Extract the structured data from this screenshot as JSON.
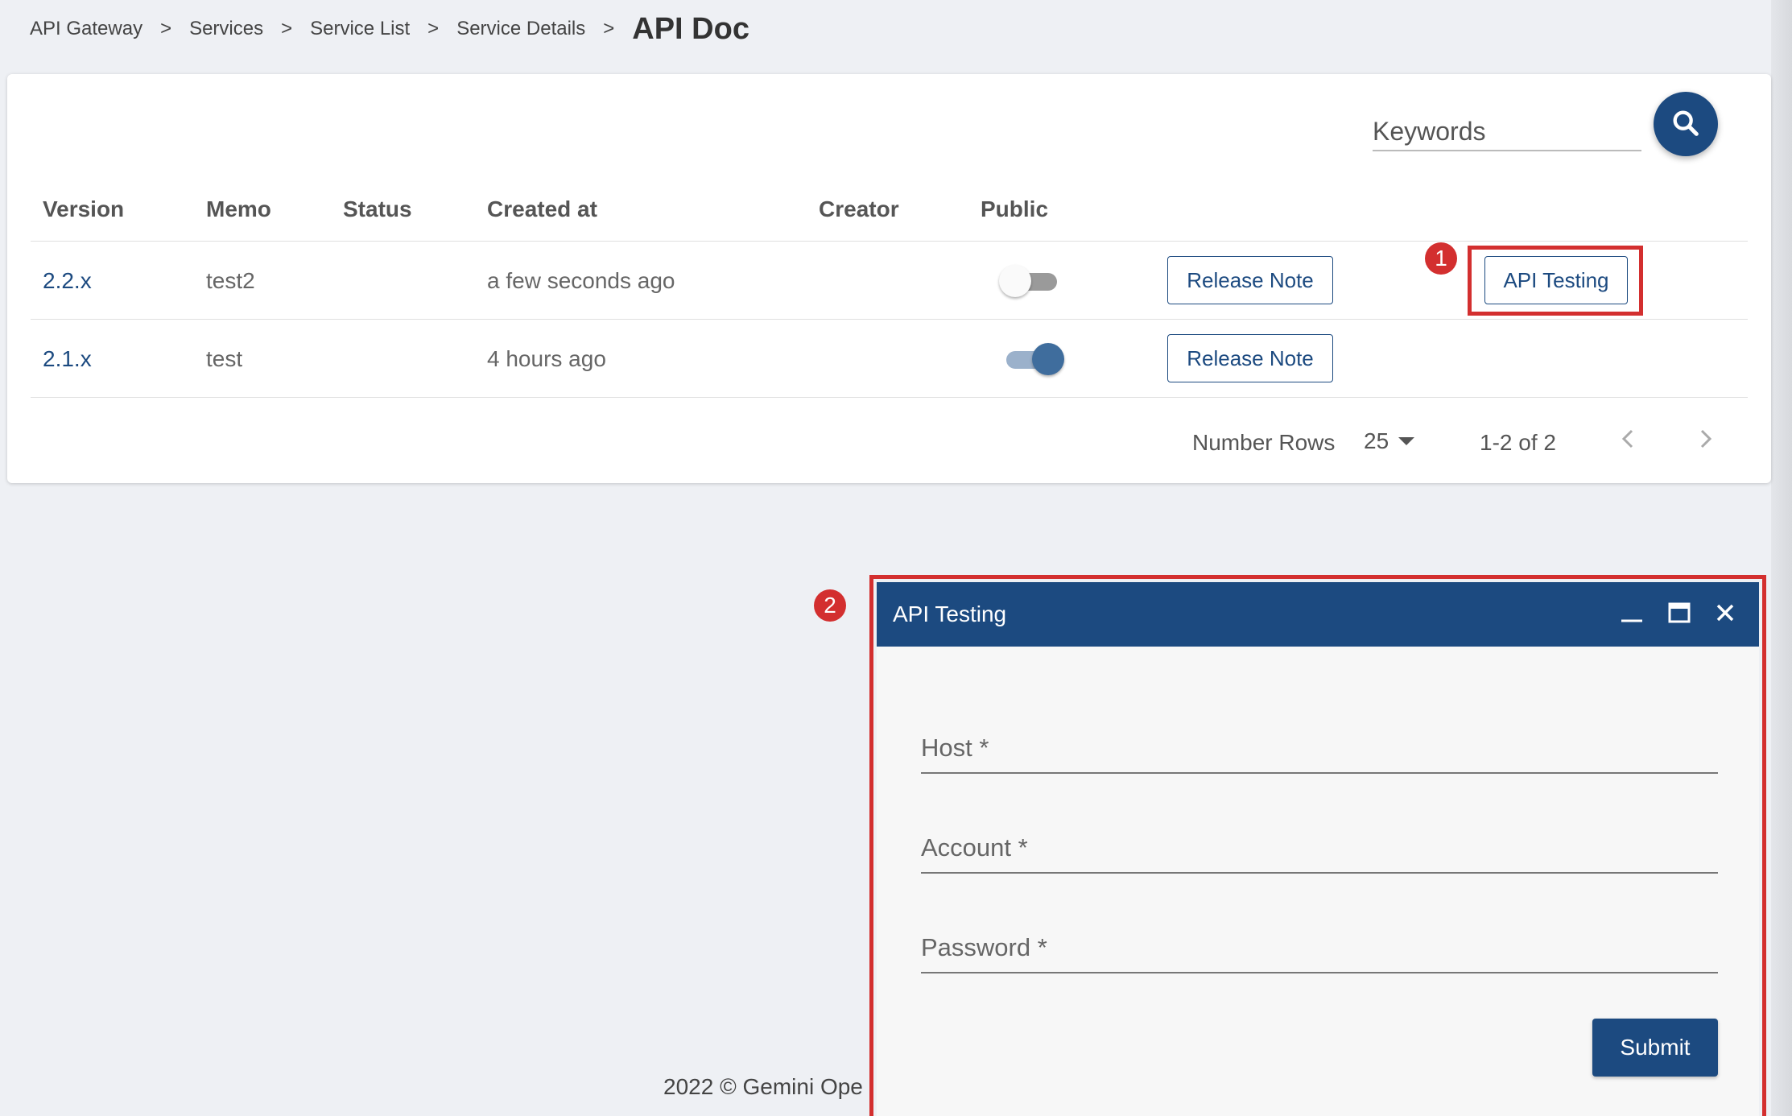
{
  "breadcrumb": {
    "items": [
      "API Gateway",
      "Services",
      "Service List",
      "Service Details"
    ],
    "current": "API Doc",
    "separator": ">"
  },
  "search": {
    "placeholder": "Keywords"
  },
  "table": {
    "columns": [
      "Version",
      "Memo",
      "Status",
      "Created at",
      "Creator",
      "Public"
    ],
    "rows": [
      {
        "version": "2.2.x",
        "memo": "test2",
        "status": "",
        "created_at": "a few seconds ago",
        "creator": "",
        "public": false,
        "release_note_label": "Release Note",
        "api_testing_label": "API Testing"
      },
      {
        "version": "2.1.x",
        "memo": "test",
        "status": "",
        "created_at": "4 hours ago",
        "creator": "",
        "public": true,
        "release_note_label": "Release Note"
      }
    ]
  },
  "pagination": {
    "rows_label": "Number Rows",
    "rows_per_page": "25",
    "range": "1-2 of 2"
  },
  "annotations": {
    "badge1": "1",
    "badge2": "2"
  },
  "dialog": {
    "title": "API Testing",
    "fields": [
      {
        "label": "Host *"
      },
      {
        "label": "Account *"
      },
      {
        "label": "Password *"
      }
    ],
    "submit_label": "Submit"
  },
  "footer": {
    "text": "2022 © Gemini Ope"
  },
  "colors": {
    "primary": "#1c4a80",
    "annotation": "#d32f2f",
    "background": "#eef0f4"
  }
}
